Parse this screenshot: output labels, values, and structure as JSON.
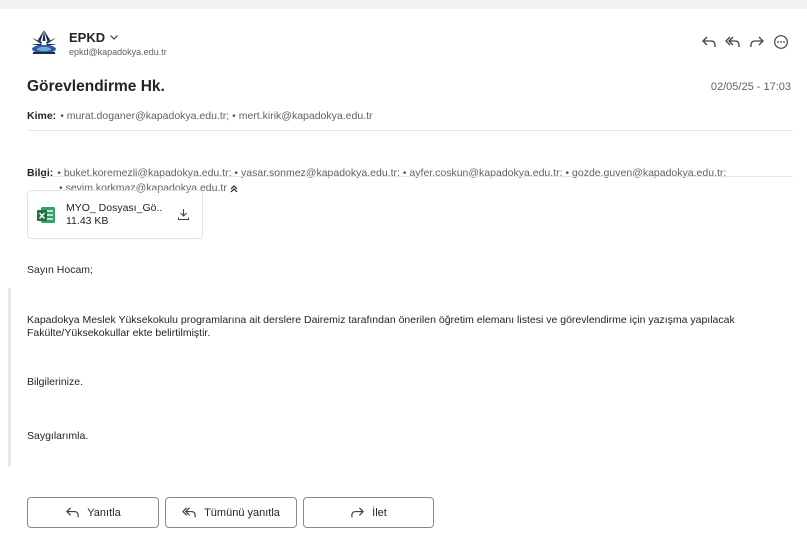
{
  "sender": {
    "name": "EPKD",
    "email": "epkd@kapadokya.edu.tr"
  },
  "subject": "Görevlendirme Hk.",
  "datetime": "02/05/25 - 17:03",
  "to": {
    "label": "Kime:",
    "addresses": "• murat.doganer@kapadokya.edu.tr; • mert.kirik@kapadokya.edu.tr"
  },
  "cc": {
    "label": "Bilgi:",
    "line1": "• buket.koremezli@kapadokya.edu.tr; • yasar.sonmez@kapadokya.edu.tr; • ayfer.coskun@kapadokya.edu.tr; • gozde.guven@kapadokya.edu.tr;",
    "line2": "• sevim.korkmaz@kapadokya.edu.tr"
  },
  "attachment": {
    "name": "MYO_ Dosyası_Gö..",
    "size": "11.43 KB"
  },
  "body": {
    "greeting": "Sayın Hocam;",
    "para1_line1": "Kapadokya Meslek Yüksekokulu programlarına ait derslere Dairemiz tarafından önerilen öğretim elemanı listesi ve görevlendirme için yazışma yapılacak",
    "para1_line2": "Fakülte/Yüksekokullar ekte belirtilmiştir.",
    "para2": "Bilgilerinize.",
    "closing": "Saygılarımla."
  },
  "buttons": {
    "reply": "Yanıtla",
    "reply_all": "Tümünü yanıtla",
    "forward": "İlet"
  },
  "colors": {
    "text": "#242424",
    "muted": "#616161",
    "excel_green": "#1f7244"
  }
}
